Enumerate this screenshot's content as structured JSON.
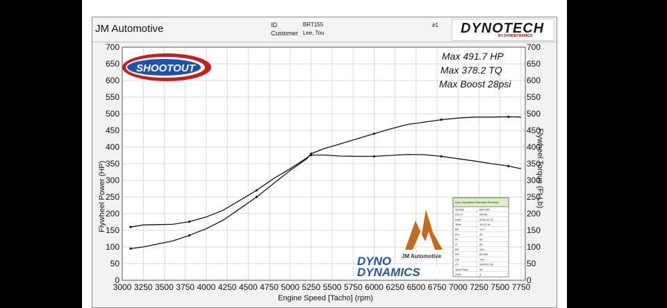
{
  "header": {
    "shop": "JM Automotive",
    "id_label": "ID",
    "id_value": "BRT155",
    "customer_label": "Customer",
    "customer_value": "Lee, Tou",
    "run_number": "#1",
    "brand_logo_text": "DYNOTECH",
    "brand_logo_sub": "BY DYNODYNAMICS"
  },
  "logos": {
    "shootout": "SHOOTOUT",
    "dyno_dynamics_line1": "DYNO",
    "dyno_dynamics_line2": "DYNAMICS",
    "jm_logo_text": "JM Automotive"
  },
  "summary_table": {
    "title": "Dyno Dynamics Standard Shootout",
    "rows": [
      [
        "Vehicle",
        "BRT155"
      ],
      [
        "Run #",
        "00008"
      ],
      [
        "Date",
        "2018-11-01"
      ],
      [
        "Time",
        "10:02:16"
      ],
      [
        "BP",
        "14.3"
      ],
      [
        "RH",
        "45"
      ],
      [
        "AT",
        "59"
      ],
      [
        "IT",
        "65"
      ],
      [
        "BS",
        "100"
      ],
      [
        "RS",
        "80.000"
      ],
      [
        "CB",
        "734"
      ],
      [
        "CF",
        "SHOOT 66"
      ],
      [
        "Total Pass",
        "46"
      ],
      [
        "Gear",
        "4"
      ]
    ]
  },
  "chart_data": {
    "type": "line",
    "xlabel": "Engine Speed [Tacho] (rpm)",
    "ylabel": "Flywheel Power (HP)",
    "y2label": "Flywheel Torque (Ft.Lb)",
    "xlim": [
      3000,
      7800
    ],
    "ylim": [
      0,
      700
    ],
    "y2lim": [
      0,
      700
    ],
    "xticks": [
      3000,
      3250,
      3500,
      3750,
      4000,
      4250,
      4500,
      4750,
      5000,
      5250,
      5500,
      5750,
      6000,
      6250,
      6500,
      6750,
      7000,
      7250,
      7500,
      7750
    ],
    "yticks": [
      0,
      50,
      100,
      150,
      200,
      250,
      300,
      350,
      400,
      450,
      500,
      550,
      600,
      650,
      700
    ],
    "grid": true,
    "annotations": [
      "Max 491.7 HP",
      "Max 378.2 TQ",
      "Max Boost 28psi"
    ],
    "series": [
      {
        "x": [
          3100,
          3250,
          3400,
          3600,
          3800,
          4000,
          4200,
          4400,
          4600,
          4800,
          5000,
          5200,
          5250,
          5400,
          5600,
          5800,
          6000,
          6200,
          6400,
          6600,
          6800,
          7000,
          7200,
          7400,
          7600,
          7750
        ],
        "values": [
          95,
          100,
          108,
          118,
          135,
          155,
          180,
          215,
          250,
          290,
          330,
          365,
          380,
          395,
          410,
          425,
          440,
          455,
          468,
          475,
          482,
          487,
          490,
          490,
          491,
          490
        ]
      },
      {
        "x": [
          3100,
          3250,
          3400,
          3600,
          3800,
          4000,
          4200,
          4400,
          4600,
          4800,
          5000,
          5200,
          5250,
          5400,
          5600,
          5800,
          6000,
          6200,
          6400,
          6600,
          6800,
          7000,
          7200,
          7400,
          7600,
          7750
        ],
        "values": [
          160,
          166,
          167,
          168,
          176,
          190,
          210,
          240,
          270,
          305,
          335,
          368,
          376,
          376,
          373,
          372,
          372,
          375,
          378,
          377,
          372,
          365,
          358,
          350,
          343,
          335
        ]
      }
    ]
  }
}
